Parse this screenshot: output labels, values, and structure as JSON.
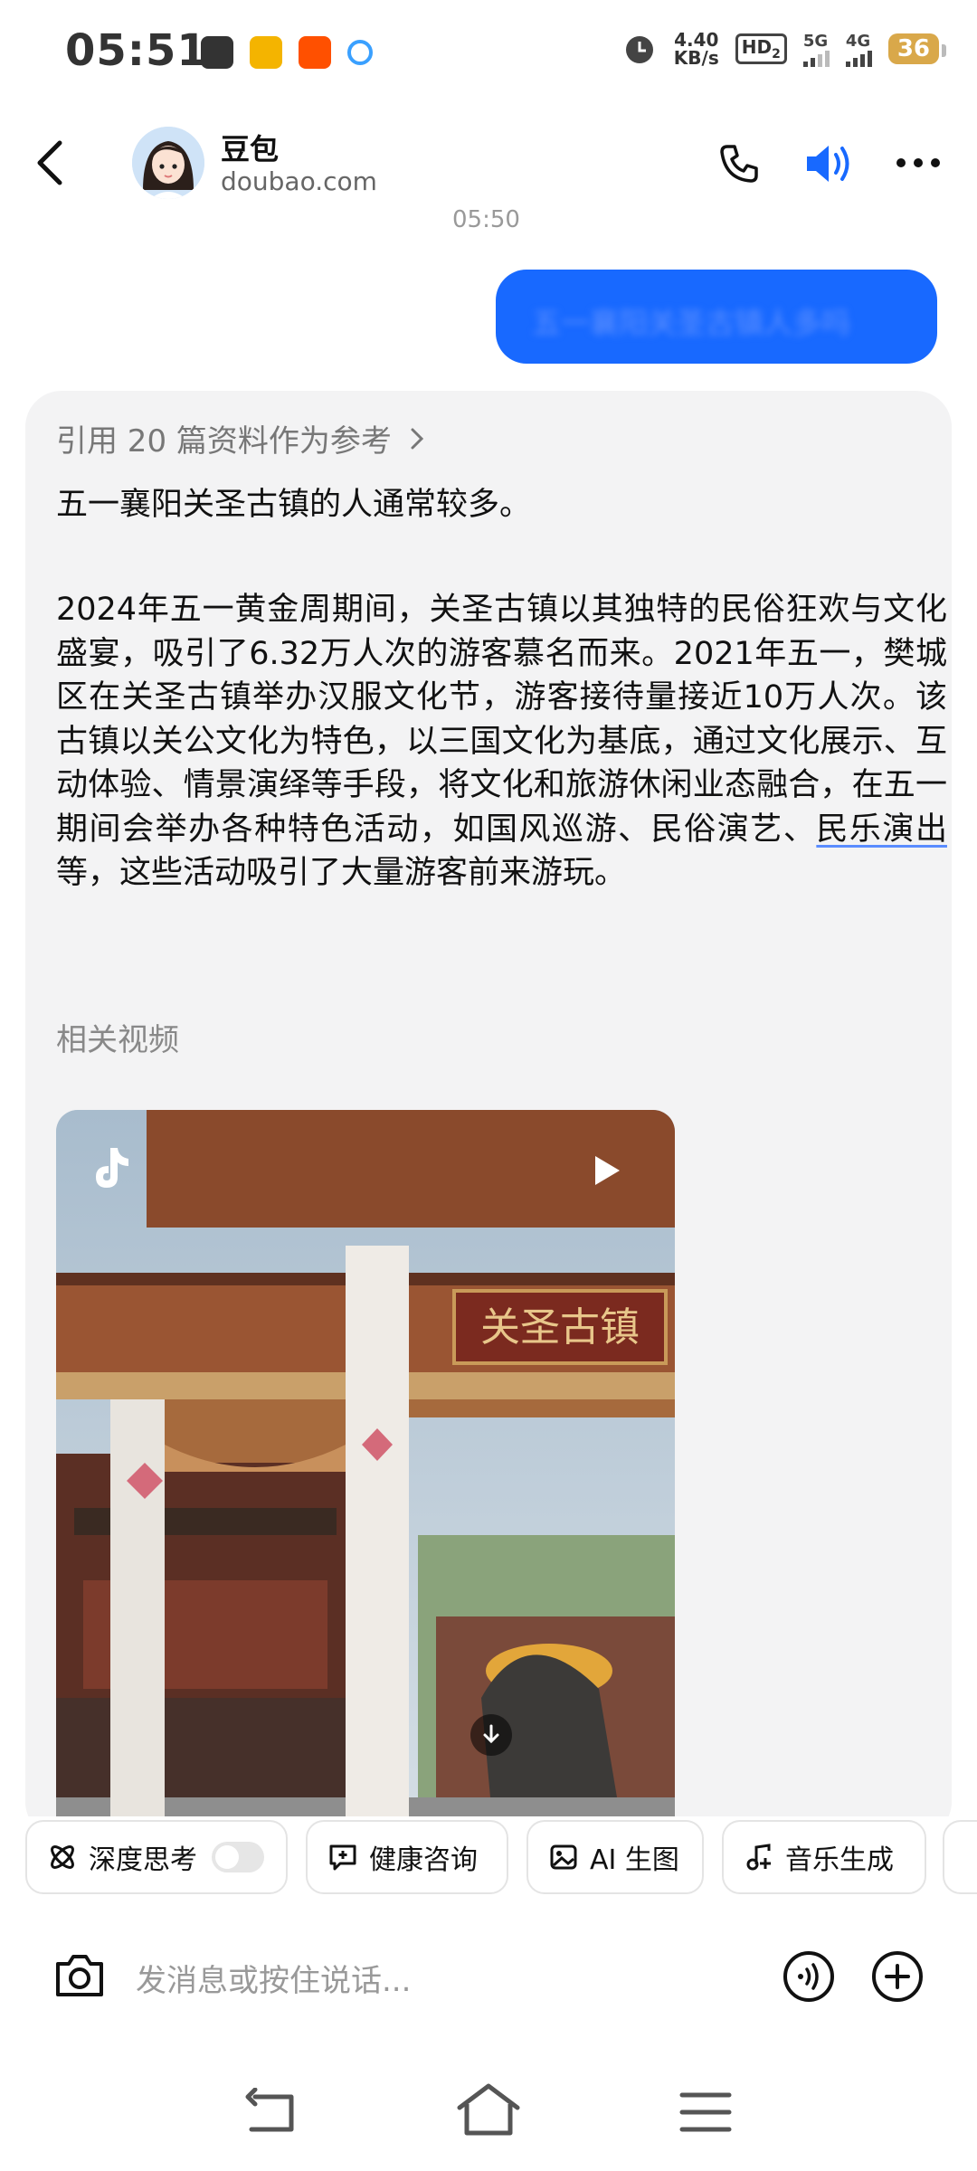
{
  "status_bar": {
    "time": "05:51",
    "net_speed_value": "4.40",
    "net_speed_unit": "KB/s",
    "hd_label": "HD",
    "hd_sub": "2",
    "sim1_type": "5G",
    "sim2_type": "4G",
    "battery": "36"
  },
  "header": {
    "name": "豆包",
    "subtitle": "doubao.com"
  },
  "chat": {
    "timestamp": "05:50",
    "user_message": "五一襄阳关圣古镇人多吗"
  },
  "answer": {
    "citation": "引用 20 篇资料作为参考",
    "summary": "五一襄阳关圣古镇的人通常较多。",
    "detail_before": "2024年五一黄金周期间，关圣古镇以其独特的民俗狂欢与文化盛宴，吸引了6.32万人次的游客慕名而来。2021年五一，樊城区在关圣古镇举办汉服文化节，游客接待量接近10万人次。该古镇以关公文化为特色，以三国文化为基底，通过文化展示、互动体验、情景演绎等手段，将文化和旅游休闲业态融合，在五一期间会举办各种特色活动，如国风巡游、民俗演艺、",
    "detail_link": "民乐演出",
    "detail_after": "等，这些活动吸引了大量游客前来游玩。",
    "videos_label": "相关视频",
    "video_sign": "关圣古镇"
  },
  "chips": [
    {
      "label": "深度思考",
      "icon": "atom-icon"
    },
    {
      "label": "健康咨询",
      "icon": "chat-plus-icon"
    },
    {
      "label": "AI 生图",
      "icon": "image-icon"
    },
    {
      "label": "音乐生成",
      "icon": "music-note-icon"
    }
  ],
  "input": {
    "placeholder": "发消息或按住说话..."
  },
  "colors": {
    "accent_blue": "#1869ff",
    "card_bg": "#f3f3f4",
    "battery": "#d9a84a"
  }
}
